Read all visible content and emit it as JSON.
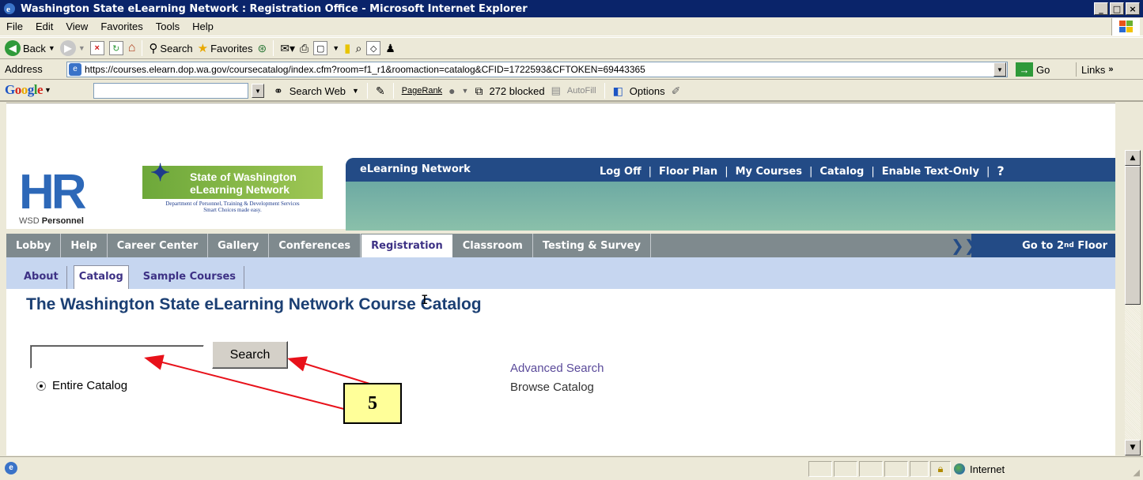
{
  "window": {
    "title": "Washington State eLearning Network : Registration Office - Microsoft Internet Explorer",
    "minimize": "_",
    "maximize": "□",
    "close": "×"
  },
  "menu": {
    "items": [
      "File",
      "Edit",
      "View",
      "Favorites",
      "Tools",
      "Help"
    ]
  },
  "toolbar": {
    "back": "Back",
    "search": "Search",
    "favorites": "Favorites"
  },
  "address": {
    "label": "Address",
    "url": "https://courses.elearn.dop.wa.gov/coursecatalog/index.cfm?room=f1_r1&roomaction=catalog&CFID=1722593&CFTOKEN=69443365",
    "go": "Go",
    "links": "Links"
  },
  "google_bar": {
    "logo": "Google",
    "search_web": "Search Web",
    "pagerank": "PageRank",
    "blocked": "272 blocked",
    "autofill": "AutoFill",
    "options": "Options"
  },
  "site": {
    "hr_letters": "HR",
    "hr_sub_prefix": "WSD",
    "hr_sub_bold": "Personnel",
    "wa_logo_line1": "State of Washington",
    "wa_logo_line2": "eLearning Network",
    "wa_tagline1": "Department of Personnel, Training & Development Services",
    "wa_tagline2": "Smart Choices made easy.",
    "network_title": "eLearning Network",
    "top_nav": [
      "Log Off",
      "Floor Plan",
      "My Courses",
      "Catalog",
      "Enable Text-Only"
    ],
    "help": "?"
  },
  "main_nav": {
    "tabs": [
      "Lobby",
      "Help",
      "Career Center",
      "Gallery",
      "Conferences",
      "Registration",
      "Classroom",
      "Testing & Survey"
    ],
    "active": "Registration",
    "floor_prefix": "Go to 2",
    "floor_sup": "nd",
    "floor_suffix": " Floor"
  },
  "sub_nav": {
    "tabs": [
      "About",
      "Catalog",
      "Sample Courses"
    ],
    "active": "Catalog"
  },
  "content": {
    "title": "The Washington State eLearning Network Course Catalog",
    "search_value": "",
    "search_button": "Search",
    "radio_label": "Entire Catalog",
    "advanced_search": "Advanced Search",
    "browse_catalog": "Browse Catalog"
  },
  "annotation": {
    "label": "5",
    "arrow_color": "#e8111a"
  },
  "status": {
    "zone": "Internet"
  },
  "colors": {
    "title_bar": "#0a246a",
    "nav_grey": "#7f8a8e",
    "navy": "#234b86",
    "active_tab_text": "#3d3185",
    "page_title": "#1b3f73",
    "subnav_bg": "#c6d6f0"
  }
}
